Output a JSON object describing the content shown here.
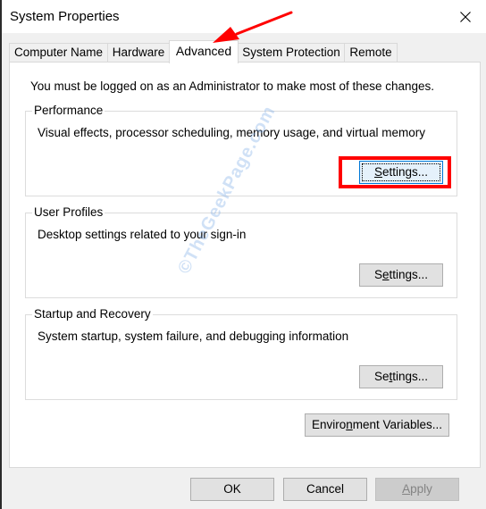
{
  "window": {
    "title": "System Properties",
    "close_icon": "close-icon"
  },
  "tabs": [
    {
      "label": "Computer Name",
      "active": false
    },
    {
      "label": "Hardware",
      "active": false
    },
    {
      "label": "Advanced",
      "active": true
    },
    {
      "label": "System Protection",
      "active": false
    },
    {
      "label": "Remote",
      "active": false
    }
  ],
  "advanced": {
    "admin_note": "You must be logged on as an Administrator to make most of these changes.",
    "performance": {
      "label": "Performance",
      "description": "Visual effects, processor scheduling, memory usage, and virtual memory",
      "button": {
        "pre": "",
        "accel": "S",
        "post": "ettings..."
      }
    },
    "user_profiles": {
      "label": "User Profiles",
      "description": "Desktop settings related to your sign-in",
      "button": {
        "pre": "S",
        "accel": "e",
        "post": "ttings..."
      }
    },
    "startup_recovery": {
      "label": "Startup and Recovery",
      "description": "System startup, system failure, and debugging information",
      "button": {
        "pre": "Se",
        "accel": "t",
        "post": "tings..."
      }
    },
    "env_button": {
      "pre": "Enviro",
      "accel": "n",
      "post": "ment Variables..."
    }
  },
  "footer": {
    "ok": "OK",
    "cancel": "Cancel",
    "apply": {
      "pre": "",
      "accel": "A",
      "post": "pply"
    }
  },
  "annotations": {
    "watermark": "©TheGeekPage.com",
    "highlight_color": "#ff0000",
    "arrow_color": "#ff0000"
  }
}
